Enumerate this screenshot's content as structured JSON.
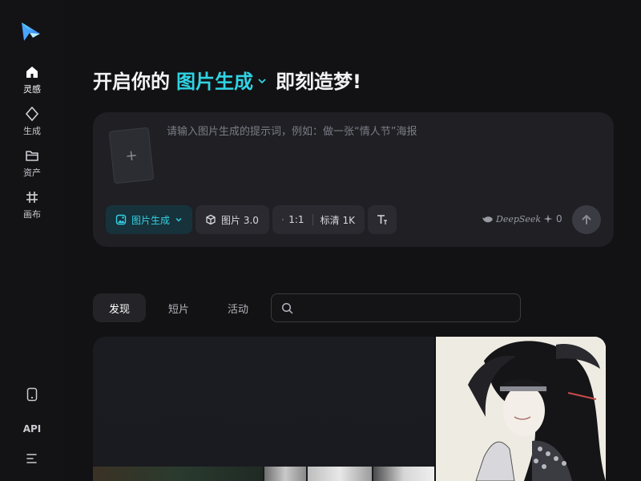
{
  "colors": {
    "background": "#121214",
    "accent": "#2fd3e4",
    "card": "#1f1f24",
    "chip": "#2a2a30"
  },
  "sidebar": {
    "logo_icon": "paper-plane-logo-icon",
    "items": [
      {
        "label": "灵感",
        "icon": "home-icon",
        "active": true
      },
      {
        "label": "生成",
        "icon": "diamond-icon",
        "active": false
      },
      {
        "label": "资产",
        "icon": "folder-icon",
        "active": false
      },
      {
        "label": "画布",
        "icon": "canvas-grid-icon",
        "active": false
      }
    ],
    "bottom": {
      "device_icon": "tablet-icon",
      "api_label": "API",
      "menu_icon": "menu-icon"
    }
  },
  "headline": {
    "prefix": "开启你的",
    "mode": "图片生成",
    "suffix": "即刻造梦!"
  },
  "prompt": {
    "placeholder": "请输入图片生成的提示词，例如：做一张“情人节”海报",
    "value": "",
    "add_image_icon": "plus-icon",
    "mode_chip": "图片生成",
    "model_chip": "图片 3.0",
    "ratio": "1:1",
    "quality": "标清 1K",
    "text_icon": "text-style-icon",
    "deepseek_label": "DeepSeek",
    "credits": "0",
    "send_icon": "arrow-up-icon"
  },
  "tabs": [
    {
      "label": "发现",
      "active": true
    },
    {
      "label": "短片",
      "active": false
    },
    {
      "label": "活动",
      "active": false
    }
  ],
  "search": {
    "placeholder": "",
    "value": ""
  }
}
